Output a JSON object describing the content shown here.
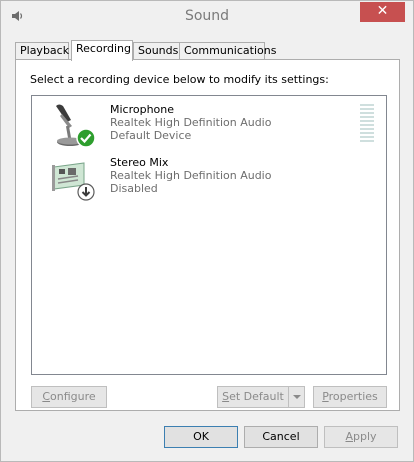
{
  "window": {
    "title": "Sound",
    "close_glyph": "✕"
  },
  "tabs": [
    {
      "label": "Playback",
      "active": false
    },
    {
      "label": "Recording",
      "active": true
    },
    {
      "label": "Sounds",
      "active": false
    },
    {
      "label": "Communications",
      "active": false
    }
  ],
  "instructions": "Select a recording device below to modify its settings:",
  "devices": [
    {
      "name": "Microphone",
      "driver": "Realtek High Definition Audio",
      "status": "Default Device",
      "icon": "microphone-icon",
      "badge": "green-check-icon",
      "level_meter": {
        "bars": 10,
        "level": 0
      }
    },
    {
      "name": "Stereo Mix",
      "driver": "Realtek High Definition Audio",
      "status": "Disabled",
      "icon": "sound-card-icon",
      "badge": "disabled-down-arrow-icon"
    }
  ],
  "panel_buttons": {
    "configure": {
      "access_key": "C",
      "rest": "onfigure"
    },
    "set_default": {
      "access_key": "S",
      "rest": "et Default"
    },
    "properties": {
      "access_key": "P",
      "rest": "roperties"
    }
  },
  "dialog_buttons": {
    "ok": "OK",
    "cancel": "Cancel",
    "apply": {
      "access_key": "A",
      "rest": "pply"
    }
  },
  "colors": {
    "close_button": "#c75050",
    "level_meter": "#cfdfde",
    "default_check": "#2e9e2e"
  }
}
